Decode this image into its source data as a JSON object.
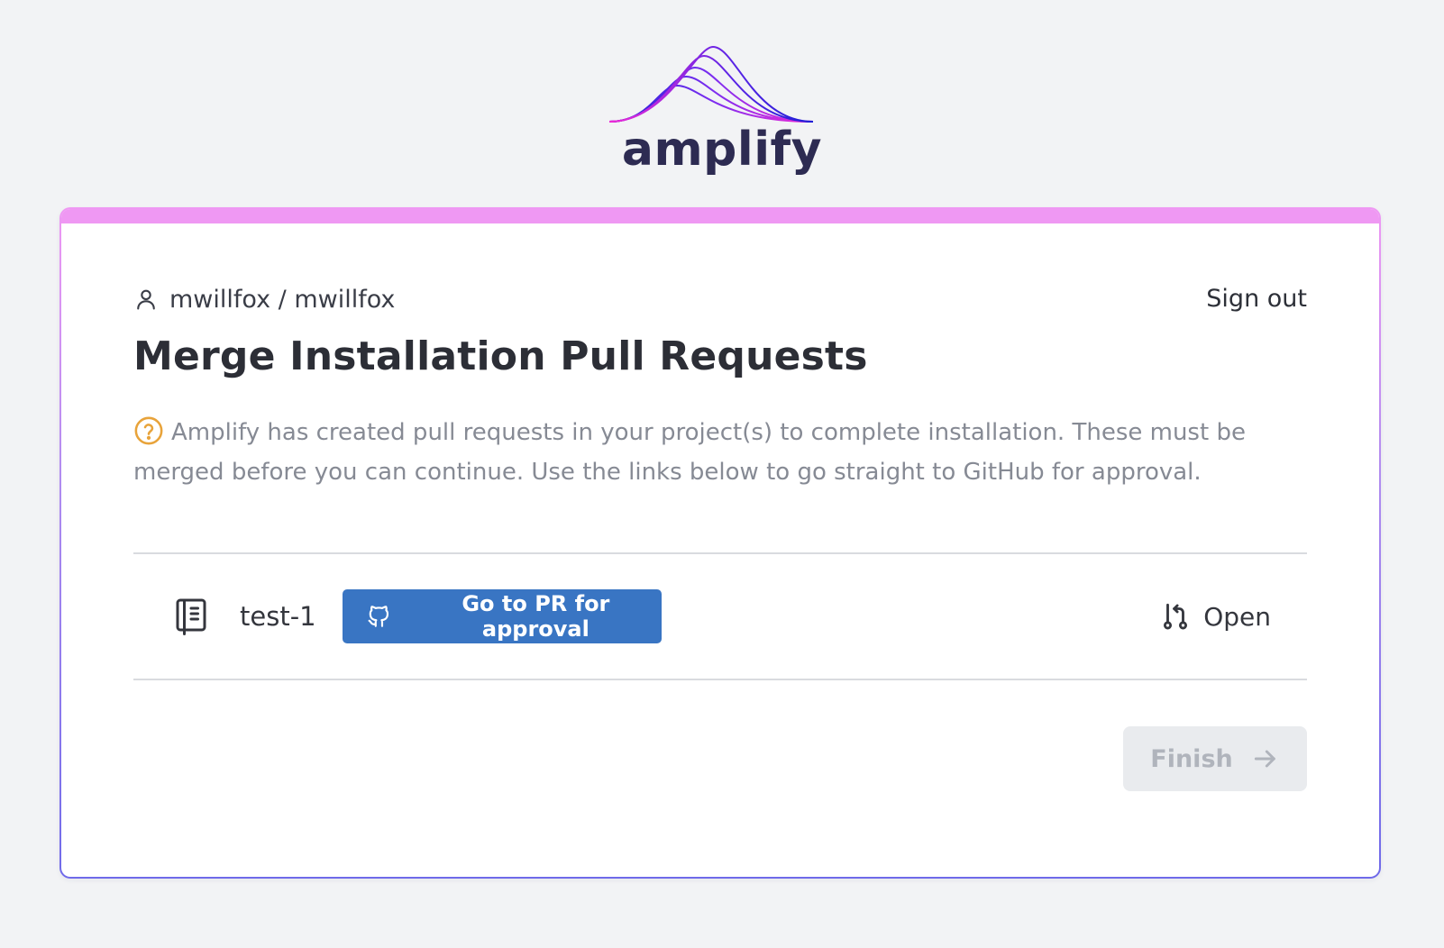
{
  "brand": {
    "name": "amplify",
    "logo_icon": "wave-logo-icon",
    "gradient_colors": [
      "#1f1fd6",
      "#7a2df0",
      "#f02ad6"
    ]
  },
  "card": {
    "accent_color": "#ef98f3",
    "user": {
      "icon": "user-icon",
      "label": "mwillfox / mwillfox"
    },
    "sign_out_label": "Sign out",
    "title": "Merge Installation Pull Requests",
    "description": {
      "icon": "help-circle-icon",
      "icon_color": "#e8a33a",
      "text": "Amplify has created pull requests in your project(s) to complete installation. These must be merged before you can continue. Use the links below to go straight to GitHub for approval."
    },
    "pull_requests": [
      {
        "repo_icon": "repository-icon",
        "repo_name": "test-1",
        "button_icon": "github-icon",
        "button_label": "Go to PR for approval",
        "button_color": "#3975c3",
        "status_icon": "pull-request-icon",
        "status": "Open"
      }
    ],
    "finish": {
      "label": "Finish",
      "icon": "arrow-right-icon",
      "disabled": true
    }
  }
}
